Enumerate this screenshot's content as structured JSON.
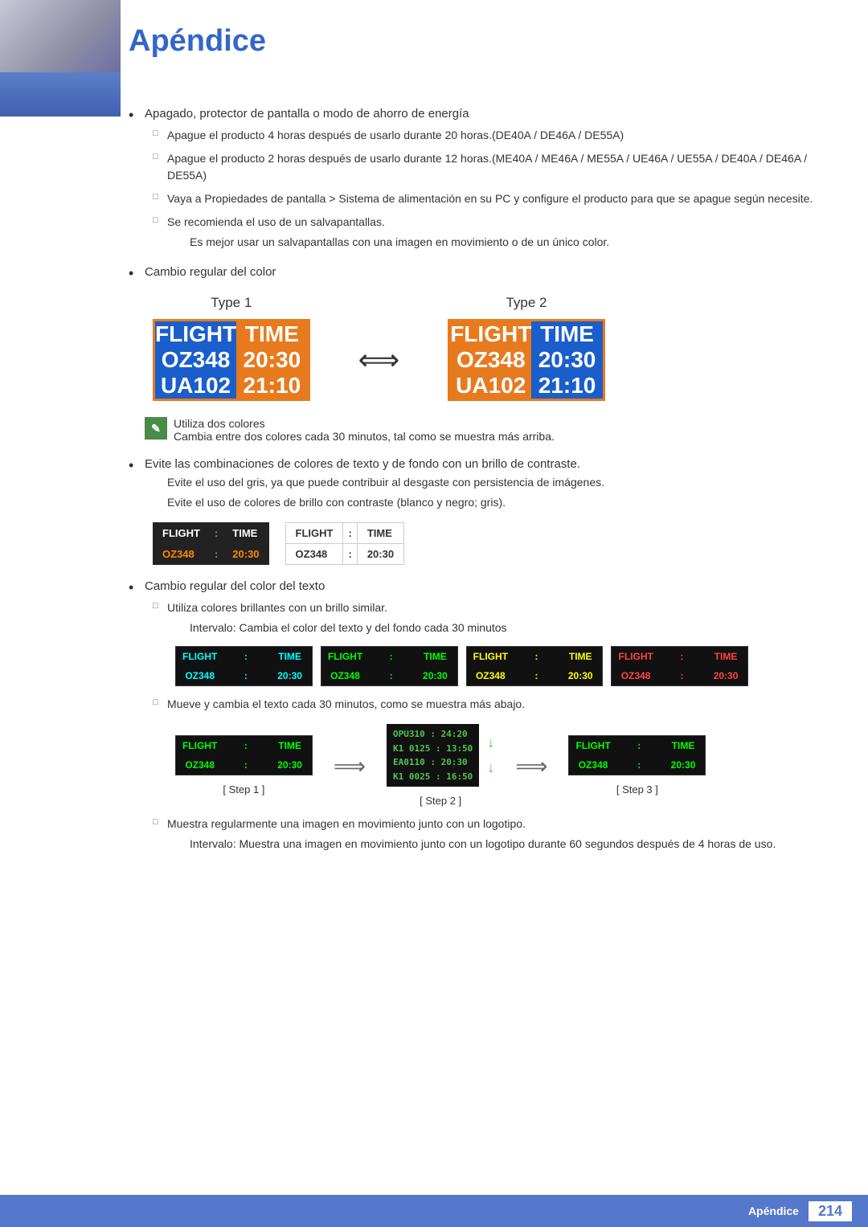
{
  "header": {
    "title": "Apéndice"
  },
  "footer": {
    "label": "Apéndice",
    "page_number": "214"
  },
  "content": {
    "bullet1": "Apagado, protector de pantalla o modo de ahorro de energía",
    "sub1a": "Apague el producto 4 horas después de usarlo durante 20 horas.(DE40A / DE46A / DE55A)",
    "sub1b": "Apague el producto 2 horas después de usarlo durante 12 horas.(ME40A / ME46A / ME55A / UE46A / UE55A / DE40A / DE46A / DE55A)",
    "sub1c": "Vaya a Propiedades de pantalla > Sistema de alimentación en su PC y configure el producto para que se apague según necesite.",
    "sub1d": "Se recomienda el uso de un salvapantallas.",
    "sub1d_note": "Es mejor usar un salvapantallas con una imagen en movimiento o de un único color.",
    "bullet2": "Cambio regular del color",
    "type1_label": "Type 1",
    "type2_label": "Type 2",
    "flight_label": "FLIGHT",
    "time_label": "TIME",
    "oz348_label": "OZ348",
    "t2030_label": "20:30",
    "ua102_label": "UA102",
    "t2110_label": "21:10",
    "note_text": "Utiliza dos colores",
    "note_sub": "Cambia entre dos colores cada 30 minutos, tal como se muestra más arriba.",
    "bullet3": "Evite las combinaciones de colores de texto y de fondo con un brillo de contraste.",
    "bullet3_sub1": "Evite el uso del gris, ya que puede contribuir al desgaste con persistencia de imágenes.",
    "bullet3_sub2": "Evite el uso de colores de brillo con contraste (blanco y negro; gris).",
    "bullet4": "Cambio regular del color del texto",
    "sub4a": "Utiliza colores brillantes con un brillo similar.",
    "sub4a_note": "Intervalo: Cambia el color del texto y del fondo cada 30 minutos",
    "sub4b_note": "Mueve y cambia el texto cada 30 minutos, como se muestra más abajo.",
    "step1_label": "[ Step 1 ]",
    "step2_label": "[ Step 2 ]",
    "step3_label": "[ Step 3 ]",
    "scroll_line1": "OPU310 : 24:20",
    "scroll_line2": "K1 0125 : 13:50",
    "scroll_line3": "EA0110 : 20:30",
    "scroll_line4": "K1 0025 : 16:50",
    "sub4c": "Muestra regularmente una imagen en movimiento junto con un logotipo.",
    "sub4c_note": "Intervalo: Muestra una imagen en movimiento junto con un logotipo durante 60 segundos después de 4 horas de uso."
  }
}
